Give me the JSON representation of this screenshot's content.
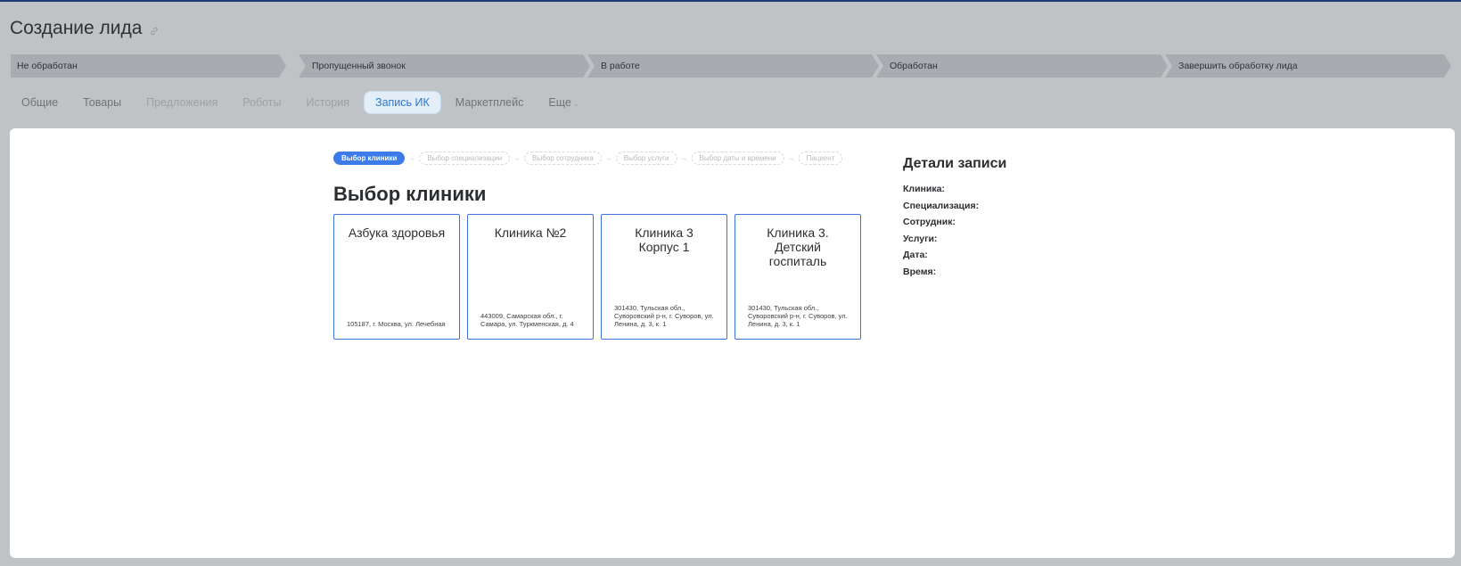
{
  "page": {
    "title": "Создание лида"
  },
  "stages": [
    {
      "label": "Не обработан"
    },
    {
      "label": "Пропущенный звонок"
    },
    {
      "label": "В работе"
    },
    {
      "label": "Обработан"
    },
    {
      "label": "Завершить обработку лида"
    }
  ],
  "tabs": [
    {
      "label": "Общие"
    },
    {
      "label": "Товары"
    },
    {
      "label": "Предложения"
    },
    {
      "label": "Роботы"
    },
    {
      "label": "История"
    },
    {
      "label": "Запись ИК"
    },
    {
      "label": "Маркетплейс"
    },
    {
      "label": "Еще"
    }
  ],
  "wizard": {
    "steps": [
      {
        "label": "Выбор клиники"
      },
      {
        "label": "Выбор специализации"
      },
      {
        "label": "Выбор сотрудника"
      },
      {
        "label": "Выбор услуги"
      },
      {
        "label": "Выбор даты и времени"
      },
      {
        "label": "Пациент"
      }
    ],
    "arrow": "→",
    "section_title": "Выбор клиники"
  },
  "clinics": [
    {
      "name": "Азбука здоровья",
      "address": "105187, г. Москва, ул. Лечебная"
    },
    {
      "name": "Клиника №2",
      "address": "443009, Самарская обл., г. Самара, ул. Туркменская, д. 4"
    },
    {
      "name": "Клиника 3 Корпус 1",
      "address": "301430, Тульская обл., Суворовский р-н, г. Суворов, ул. Ленина, д. 3, к. 1"
    },
    {
      "name": "Клиника 3. Детский госпиталь",
      "address": "301430, Тульская обл., Суворовский р-н, г. Суворов, ул. Ленина, д. 3, к. 1"
    }
  ],
  "details": {
    "title": "Детали записи",
    "fields": [
      "Клиника:",
      "Специализация:",
      "Сотрудник:",
      "Услуги:",
      "Дата:",
      "Время:"
    ]
  },
  "colors": {
    "overlay_bg": "#bfc3c6",
    "accent": "#3d7be8",
    "card_border": "#3d72e0",
    "active_tab_text": "#2e77c8"
  },
  "icons": {
    "title_link": "link-icon",
    "more_tab": "chevron-down-icon"
  }
}
